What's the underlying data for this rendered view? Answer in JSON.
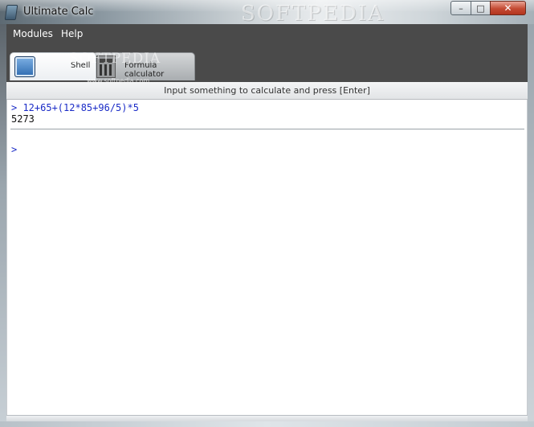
{
  "window": {
    "title": "Ultimate Calc",
    "watermark": "SOFTPEDIA",
    "controls": {
      "minimize": "–",
      "maximize": "□",
      "close": "✕"
    }
  },
  "menu": {
    "items": [
      "Modules",
      "Help"
    ]
  },
  "tabs": [
    {
      "label": "Shell",
      "icon": "shell-icon",
      "active": true
    },
    {
      "label": "Formula calculator",
      "icon": "calculator-icon",
      "active": false
    }
  ],
  "tab_watermark": {
    "text": "SOFTPEDIA",
    "sub": "www.softpedia.com"
  },
  "hint": "Input something to calculate and press [Enter]",
  "shell": {
    "history": [
      {
        "input": "> 12+65+(12*85+96/5)*5",
        "output": "5273"
      }
    ],
    "prompt": ">",
    "current_input": ""
  },
  "colors": {
    "input_text": "#1b2cc7",
    "dark_panel": "#4a4a4a",
    "close_button": "#c44a33"
  }
}
